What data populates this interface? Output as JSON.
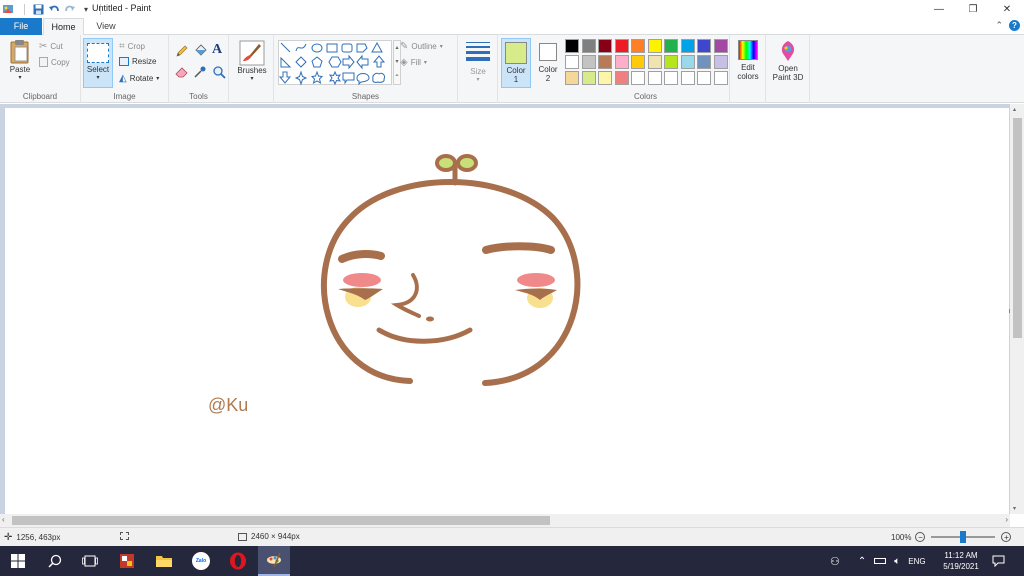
{
  "window": {
    "title": "Untitled - Paint",
    "minimize_glyph": "—",
    "maximize_glyph": "❐",
    "close_glyph": "✕"
  },
  "tabs": {
    "file": "File",
    "home": "Home",
    "view": "View"
  },
  "ribbon": {
    "clipboard": {
      "label": "Clipboard",
      "paste": "Paste",
      "cut": "Cut",
      "copy": "Copy"
    },
    "image": {
      "label": "Image",
      "select": "Select",
      "crop": "Crop",
      "resize": "Resize",
      "rotate": "Rotate"
    },
    "tools": {
      "label": "Tools"
    },
    "brushes": {
      "label": "Brushes"
    },
    "shapes": {
      "label": "Shapes",
      "outline": "Outline",
      "fill": "Fill"
    },
    "size": {
      "label": "Size"
    },
    "color1": {
      "label": "Color",
      "number": "1",
      "value": "#d8eb8a"
    },
    "color2": {
      "label": "Color",
      "number": "2",
      "value": "#ffffff"
    },
    "colors": {
      "label": "Colors",
      "edit": "Edit colors",
      "edit_line1": "Edit",
      "edit_line2": "colors",
      "row1": [
        "#000000",
        "#7f7f7f",
        "#880015",
        "#ed1c24",
        "#ff7f27",
        "#fff200",
        "#22b14c",
        "#00a2e8",
        "#3f48cc",
        "#a349a4"
      ],
      "row2": [
        "#ffffff",
        "#c3c3c3",
        "#b97a57",
        "#ffaec9",
        "#ffc90e",
        "#efe4b0",
        "#b5e61d",
        "#99d9ea",
        "#7092be",
        "#c8bfe7"
      ],
      "row3": [
        "#f5d79a",
        "#d8eb8a",
        "#fdf6a8",
        "#f08080",
        "#ffffff",
        "#ffffff",
        "#ffffff",
        "#ffffff",
        "#ffffff",
        "#ffffff"
      ]
    },
    "paint3d": {
      "line1": "Open",
      "line2": "Paint 3D"
    }
  },
  "canvas": {
    "watermark": "@Ku",
    "brown": "#a86f4c",
    "blush": "#f08a8a",
    "cheek": "#f9e08e",
    "leaf": "#c9e07a"
  },
  "status": {
    "cursor_pos": "1256, 463px",
    "image_size": "2460 × 944px",
    "zoom": "100%",
    "zoom_level": 1.0
  },
  "taskbar": {
    "lang": "ENG",
    "time": "11:12 AM",
    "date": "5/19/2021",
    "zalo": "Zalo"
  }
}
